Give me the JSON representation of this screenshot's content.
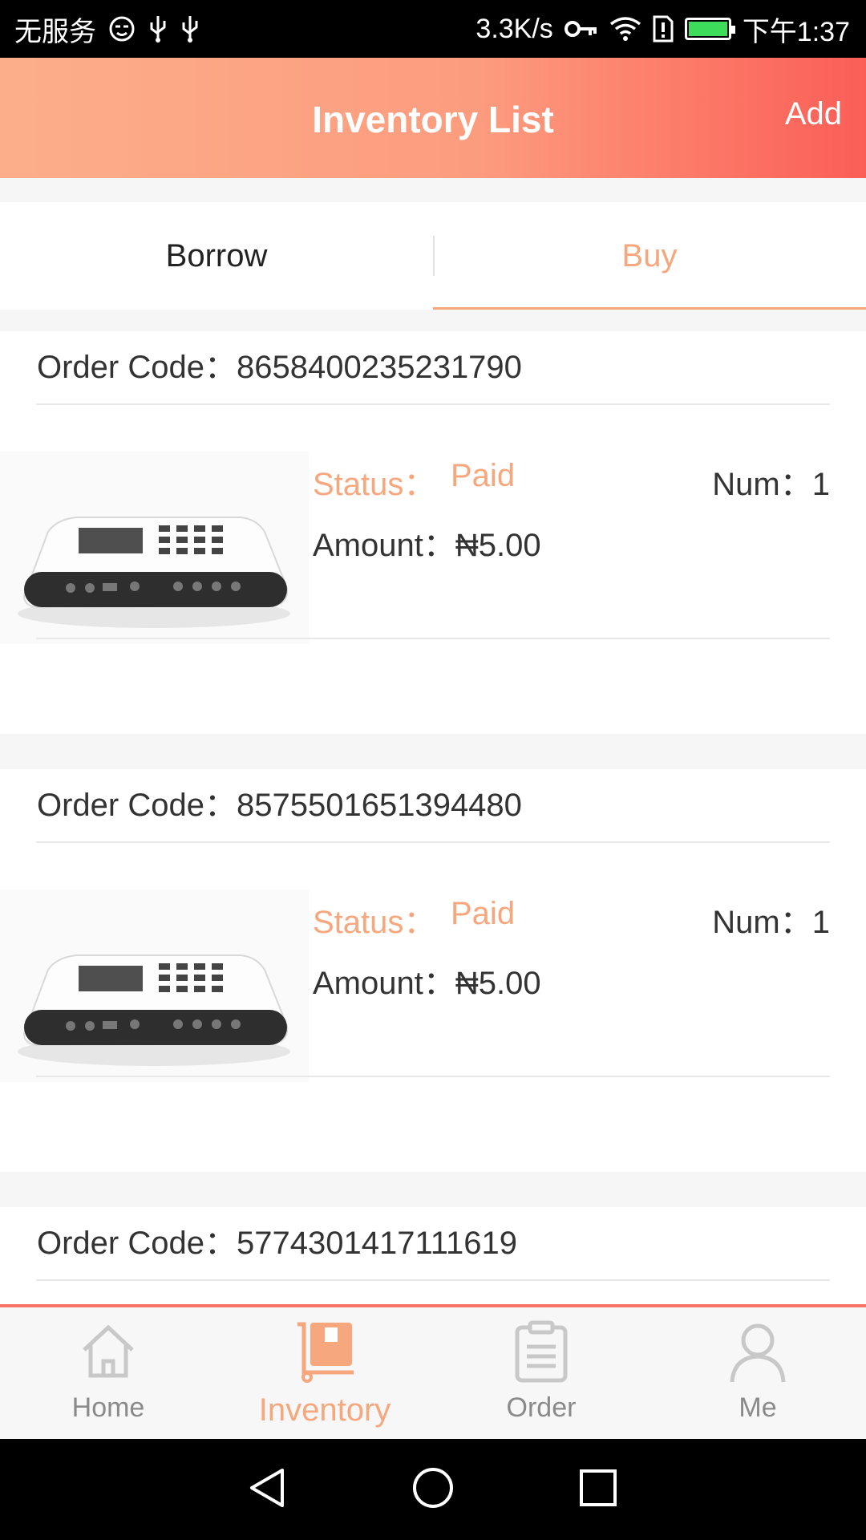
{
  "status_bar": {
    "carrier": "无服务",
    "speed": "3.3K/s",
    "time": "下午1:37"
  },
  "header": {
    "title": "Inventory List",
    "add_label": "Add"
  },
  "tabs": [
    {
      "label": "Borrow"
    },
    {
      "label": "Buy"
    }
  ],
  "orders": [
    {
      "code_label": "Order Code：",
      "code": "8658400235231790",
      "status_label": "Status：",
      "status_value": "Paid",
      "num_label": "Num：",
      "num_value": "1",
      "amount_label": "Amount：",
      "amount_value": "₦5.00"
    },
    {
      "code_label": "Order Code：",
      "code": "8575501651394480",
      "status_label": "Status：",
      "status_value": "Paid",
      "num_label": "Num：",
      "num_value": "1",
      "amount_label": "Amount：",
      "amount_value": "₦5.00"
    },
    {
      "code_label": "Order Code：",
      "code": "5774301417111619"
    }
  ],
  "bottom_nav": [
    {
      "label": "Home",
      "icon": "home-icon"
    },
    {
      "label": "Inventory",
      "icon": "inventory-cart-icon"
    },
    {
      "label": "Order",
      "icon": "clipboard-icon"
    },
    {
      "label": "Me",
      "icon": "person-icon"
    }
  ],
  "colors": {
    "accent": "#f6a77d",
    "header_gradient_start": "#fcae8a",
    "header_gradient_end": "#fb5e57"
  }
}
